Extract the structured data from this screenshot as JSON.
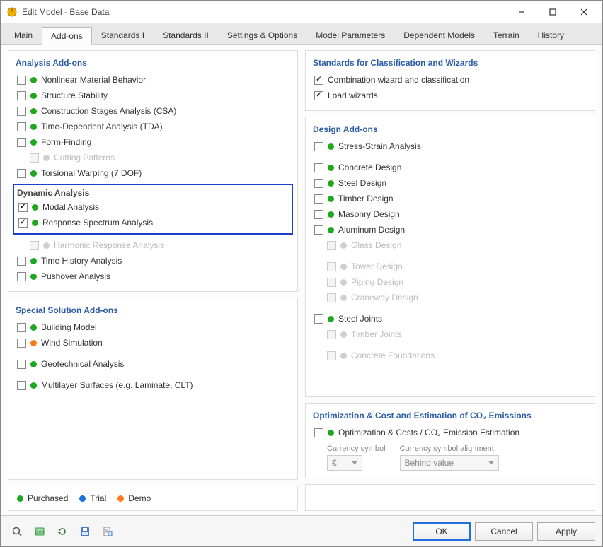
{
  "window": {
    "title": "Edit Model - Base Data"
  },
  "tabs": {
    "t0": "Main",
    "t1": "Add-ons",
    "t2": "Standards I",
    "t3": "Standards II",
    "t4": "Settings & Options",
    "t5": "Model Parameters",
    "t6": "Dependent Models",
    "t7": "Terrain",
    "t8": "History"
  },
  "analysis": {
    "header": "Analysis Add-ons",
    "items": {
      "nonlinear": "Nonlinear Material Behavior",
      "stability": "Structure Stability",
      "csa": "Construction Stages Analysis (CSA)",
      "tda": "Time-Dependent Analysis (TDA)",
      "formfinding": "Form-Finding",
      "cutting": "Cutting Patterns",
      "torsional": "Torsional Warping (7 DOF)"
    },
    "dynamic_header": "Dynamic Analysis",
    "dynamic": {
      "modal": "Modal Analysis",
      "response": "Response Spectrum Analysis",
      "harmonic": "Harmonic Response Analysis",
      "timehist": "Time History Analysis",
      "pushover": "Pushover Analysis"
    }
  },
  "special": {
    "header": "Special Solution Add-ons",
    "items": {
      "building": "Building Model",
      "wind": "Wind Simulation",
      "geo": "Geotechnical Analysis",
      "multi": "Multilayer Surfaces (e.g. Laminate, CLT)"
    }
  },
  "standards": {
    "header": "Standards for Classification and Wizards",
    "combo": "Combination wizard and classification",
    "load": "Load wizards"
  },
  "design": {
    "header": "Design Add-ons",
    "items": {
      "stress": "Stress-Strain Analysis",
      "concrete": "Concrete Design",
      "steel": "Steel Design",
      "timber": "Timber Design",
      "masonry": "Masonry Design",
      "aluminum": "Aluminum Design",
      "glass": "Glass Design",
      "tower": "Tower Design",
      "piping": "Piping Design",
      "craneway": "Craneway Design",
      "steeljoints": "Steel Joints",
      "timberjoints": "Timber Joints",
      "foundations": "Concrete Foundations"
    }
  },
  "optimization": {
    "header": "Optimization & Cost and Estimation of CO₂ Emissions",
    "item": "Optimization & Costs / CO₂ Emission Estimation",
    "currency_label": "Currency symbol",
    "currency_value": "€",
    "align_label": "Currency symbol alignment",
    "align_value": "Behind value"
  },
  "legend": {
    "purchased": "Purchased",
    "trial": "Trial",
    "demo": "Demo"
  },
  "buttons": {
    "ok": "OK",
    "cancel": "Cancel",
    "apply": "Apply"
  }
}
